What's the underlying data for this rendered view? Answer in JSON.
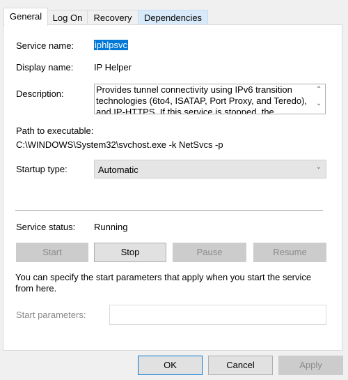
{
  "tabs": [
    {
      "label": "General",
      "selected": true
    },
    {
      "label": "Log On"
    },
    {
      "label": "Recovery"
    },
    {
      "label": "Dependencies",
      "hovered": true
    }
  ],
  "general": {
    "service_name_label": "Service name:",
    "service_name": "iphlpsvc",
    "display_name_label": "Display name:",
    "display_name": "IP Helper",
    "description_label": "Description:",
    "description": "Provides tunnel connectivity using IPv6 transition technologies (6to4, ISATAP, Port Proxy, and Teredo), and IP-HTTPS. If this service is stopped, the",
    "path_label": "Path to executable:",
    "path": "C:\\WINDOWS\\System32\\svchost.exe -k NetSvcs -p",
    "startup_type_label": "Startup type:",
    "startup_type": "Automatic",
    "service_status_label": "Service status:",
    "service_status": "Running",
    "buttons": {
      "start": "Start",
      "stop": "Stop",
      "pause": "Pause",
      "resume": "Resume"
    },
    "info_text": "You can specify the start parameters that apply when you start the service from here.",
    "start_params_label": "Start parameters:",
    "start_params_value": ""
  },
  "footer": {
    "ok": "OK",
    "cancel": "Cancel",
    "apply": "Apply"
  },
  "colors": {
    "selection": "#0078d7",
    "disabled_button": "#cccccc"
  }
}
